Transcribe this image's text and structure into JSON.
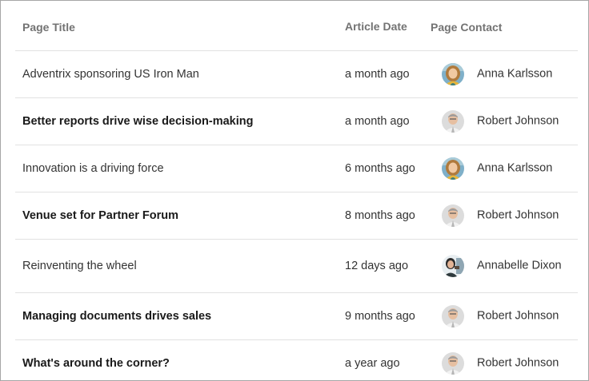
{
  "columns": {
    "title": "Page Title",
    "date": "Article Date",
    "contact": "Page Contact"
  },
  "rows": [
    {
      "title": "Adventrix sponsoring US Iron Man",
      "bold": false,
      "date": "a month ago",
      "contact": "Anna Karlsson",
      "avatar": "anna"
    },
    {
      "title": "Better reports drive wise decision-making",
      "bold": true,
      "date": "a month ago",
      "contact": "Robert Johnson",
      "avatar": "robert"
    },
    {
      "title": "Innovation is a driving force",
      "bold": false,
      "date": "6 months ago",
      "contact": "Anna Karlsson",
      "avatar": "anna"
    },
    {
      "title": "Venue set for Partner Forum",
      "bold": true,
      "date": "8 months ago",
      "contact": "Robert Johnson",
      "avatar": "robert"
    },
    {
      "title": "Reinventing the wheel",
      "bold": false,
      "date": "12 days ago",
      "contact": "Annabelle Dixon",
      "avatar": "annabelle"
    },
    {
      "title": "Managing documents drives sales",
      "bold": true,
      "date": "9 months ago",
      "contact": "Robert Johnson",
      "avatar": "robert"
    },
    {
      "title": "What's around the corner?",
      "bold": true,
      "date": "a year ago",
      "contact": "Robert Johnson",
      "avatar": "robert"
    }
  ],
  "colors": {
    "border": "#a6a6a6",
    "row_divider": "#e1e1e1",
    "header_text": "#737373",
    "body_text": "#333333"
  }
}
